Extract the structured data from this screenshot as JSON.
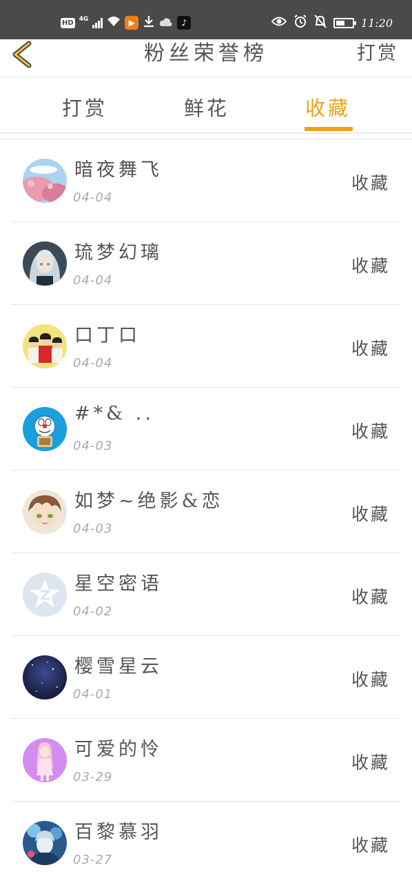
{
  "status_bar": {
    "hd_label": "HD",
    "network_label": "4G",
    "time": "11:20"
  },
  "header": {
    "title": "粉丝荣誉榜",
    "right_action": "打赏"
  },
  "tabs": [
    {
      "label": "打赏",
      "active": false
    },
    {
      "label": "鲜花",
      "active": false
    },
    {
      "label": "收藏",
      "active": true
    }
  ],
  "accent_color": "#e8a317",
  "fans": [
    {
      "name": "暗夜舞飞",
      "date": "04-04",
      "action": "收藏",
      "avatar": "cherry-blossom-avatar"
    },
    {
      "name": "琉梦幻璃",
      "date": "04-04",
      "action": "收藏",
      "avatar": "anime-girl-avatar"
    },
    {
      "name": "口丁口",
      "date": "04-04",
      "action": "收藏",
      "avatar": "group-photo-avatar"
    },
    {
      "name": "#*& ..",
      "date": "04-03",
      "action": "收藏",
      "avatar": "doraemon-avatar"
    },
    {
      "name": "如梦~绝影&恋",
      "date": "04-03",
      "action": "收藏",
      "avatar": "anime-boy-avatar"
    },
    {
      "name": "星空密语",
      "date": "04-02",
      "action": "收藏",
      "avatar": "qq-default-avatar"
    },
    {
      "name": "樱雪星云",
      "date": "04-01",
      "action": "收藏",
      "avatar": "night-sky-avatar"
    },
    {
      "name": "可爱的怜",
      "date": "03-29",
      "action": "收藏",
      "avatar": "pink-girl-avatar"
    },
    {
      "name": "百黎慕羽",
      "date": "03-27",
      "action": "收藏",
      "avatar": "fantasy-avatar"
    }
  ]
}
